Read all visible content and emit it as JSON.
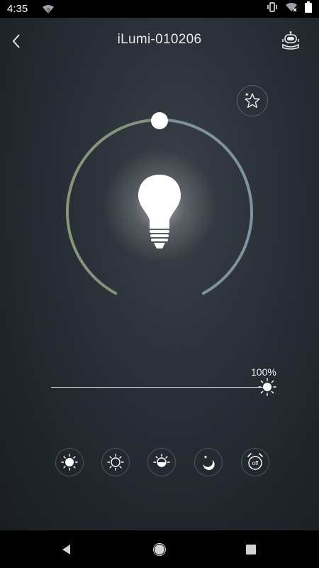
{
  "status_bar": {
    "time": "4:35",
    "wifi_icon": "wifi-question-icon",
    "vibrate_icon": "vibrate-icon",
    "signal_icon": "signal-off-icon",
    "battery_icon": "battery-icon"
  },
  "header": {
    "title": "iLumi-010206",
    "back_icon": "chevron-left-icon",
    "robot_icon": "robot-icon"
  },
  "favorite": {
    "icon": "star-icon"
  },
  "color_dial": {
    "warm_color": "#8c9478",
    "cool_color": "#7c95a0",
    "thumb_color": "#ffffff"
  },
  "brightness": {
    "percent_label": "100%",
    "value": 1.0,
    "thumb_icon": "sun-icon"
  },
  "modes": [
    {
      "name": "bright-mode",
      "icon": "sun-full-icon"
    },
    {
      "name": "normal-mode",
      "icon": "sun-outline-icon"
    },
    {
      "name": "dim-mode",
      "icon": "sun-half-icon"
    },
    {
      "name": "night-mode",
      "icon": "moon-star-icon"
    },
    {
      "name": "off-timer",
      "icon": "alarm-off-icon",
      "label": "off"
    }
  ],
  "nav_bar": {
    "back_icon": "triangle-back-icon",
    "home_icon": "circle-home-icon",
    "recents_icon": "square-recents-icon"
  }
}
